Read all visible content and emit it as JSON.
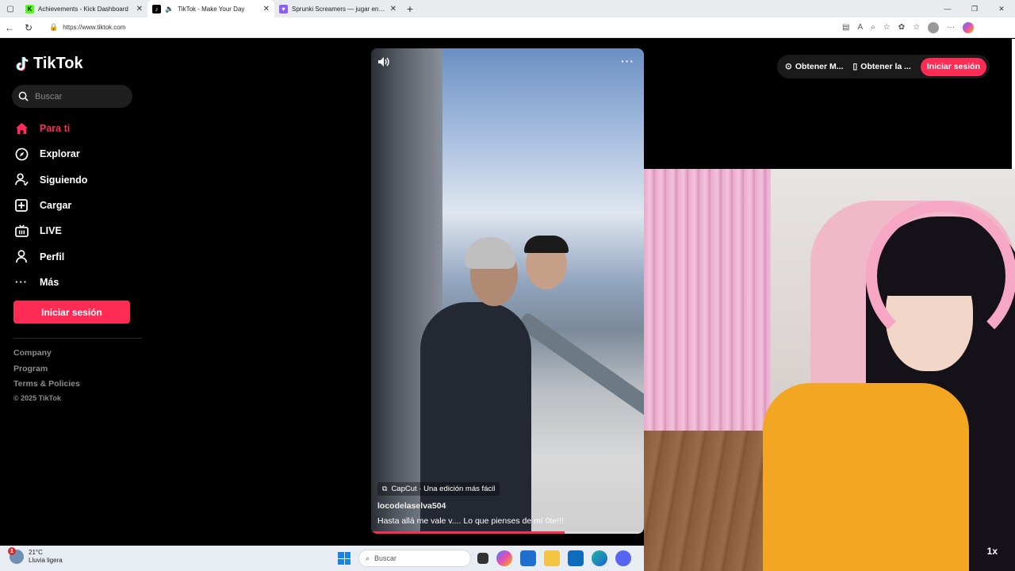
{
  "browser": {
    "tabs": [
      {
        "label": "Achievements - Kick Dashboard",
        "favicon_color": "#53fc18",
        "favicon_letter": "K",
        "active": false
      },
      {
        "label": "TikTok - Make Your Day",
        "favicon_color": "#000000",
        "favicon_letter": "♪",
        "active": true
      },
      {
        "label": "Sprunki Screamers — jugar en Pl...",
        "favicon_color": "#8b5cf6",
        "favicon_letter": "♥",
        "active": false
      }
    ],
    "new_tab": "+",
    "url": "https://www.tiktok.com"
  },
  "sidebar": {
    "logo_text": "TikTok",
    "search_placeholder": "Buscar",
    "nav_items": [
      {
        "label": "Para ti",
        "icon": "home-icon",
        "active": true
      },
      {
        "label": "Explorar",
        "icon": "compass-icon",
        "active": false
      },
      {
        "label": "Siguiendo",
        "icon": "following-icon",
        "active": false
      },
      {
        "label": "Cargar",
        "icon": "upload-icon",
        "active": false
      },
      {
        "label": "LIVE",
        "icon": "live-icon",
        "active": false
      },
      {
        "label": "Perfil",
        "icon": "profile-icon",
        "active": false
      },
      {
        "label": "Más",
        "icon": "more-icon",
        "active": false
      }
    ],
    "login_button": "Iniciar sesión",
    "footer_links": [
      "Company",
      "Program",
      "Terms & Policies"
    ],
    "copyright": "© 2025 TikTok"
  },
  "video": {
    "capcut_label": "CapCut · Una edición más fácil",
    "username": "locodelaselva504",
    "description": "Hasta allá me vale v.... Lo que pienses de mí 0te!!!",
    "progress": 0.71,
    "more": "···"
  },
  "topright": {
    "get_coins": "Obtener M...",
    "get_app": "Obtener la ...",
    "login": "Iniciar sesión"
  },
  "webcam": {
    "speed": "1x"
  },
  "taskbar": {
    "weather_badge": "1",
    "temperature": "21°C",
    "weather_desc": "Lluvia ligera",
    "search_placeholder": "Buscar"
  },
  "colors": {
    "accent": "#fe2c55",
    "sidebar_bg": "#000000"
  }
}
